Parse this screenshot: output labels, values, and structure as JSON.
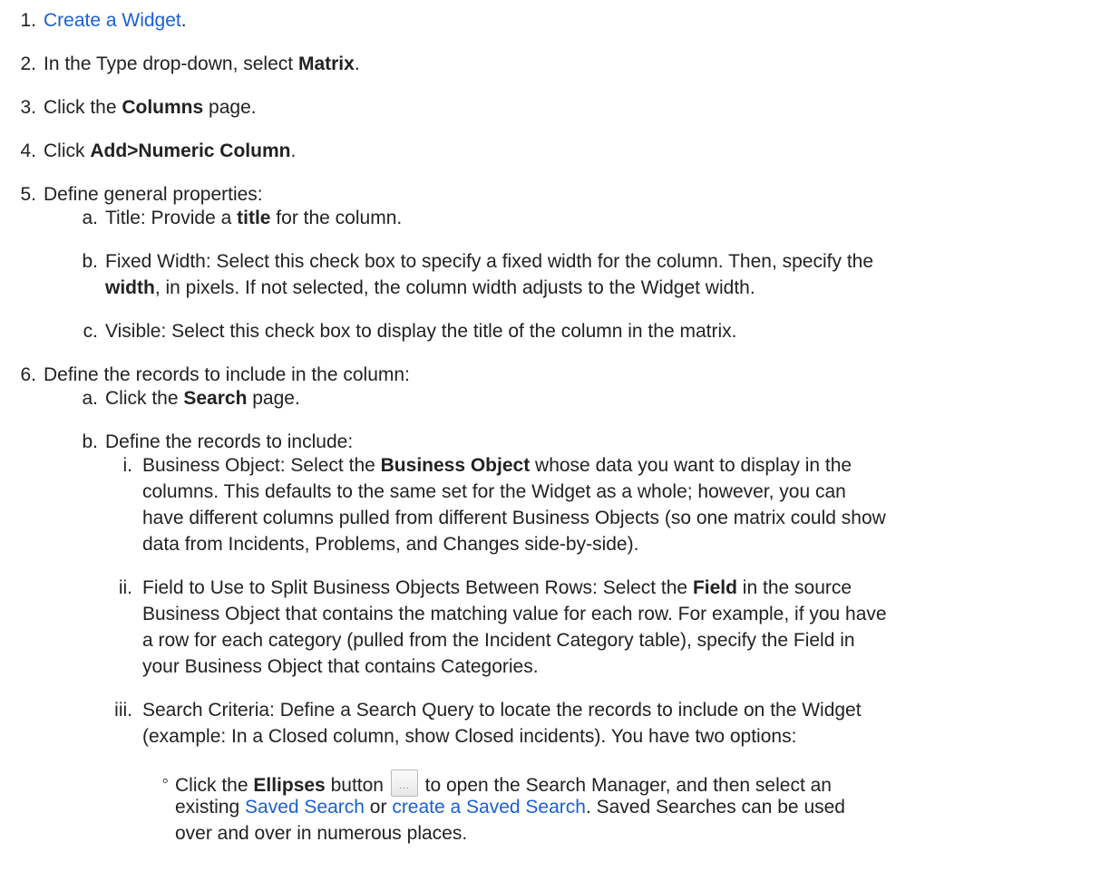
{
  "steps": [
    {
      "num": "1.",
      "link": "Create a Widget",
      "after": "."
    },
    {
      "num": "2.",
      "before": "In the Type drop-down, select ",
      "bold": "Matrix",
      "after": "."
    },
    {
      "num": "3.",
      "before": "Click the ",
      "bold": "Columns",
      "after": " page."
    },
    {
      "num": "4.",
      "before": "Click ",
      "bold": "Add>Numeric Column",
      "after": "."
    },
    {
      "num": "5.",
      "text": "Define general properties:",
      "sub": [
        {
          "num": "a.",
          "before": "Title: Provide a ",
          "bold": "title",
          "after": " for the column."
        },
        {
          "num": "b.",
          "line1": "Fixed Width: Select this check box to specify a fixed width for the column. Then, specify the",
          "bold": "width",
          "after": ", in pixels. If not selected, the column width adjusts to the Widget width."
        },
        {
          "num": "c.",
          "text": "Visible: Select this check box to display the title of the column in the matrix."
        }
      ]
    },
    {
      "num": "6.",
      "text": "Define the records to include in the column:",
      "sub": [
        {
          "num": "a.",
          "before": "Click the ",
          "bold": "Search",
          "after": " page."
        },
        {
          "num": "b.",
          "text": "Define the records to include:",
          "sub": [
            {
              "num": "i.",
              "before": "Business Object: Select the ",
              "bold": "Business Object",
              "line1_after": " whose data you want to display in the",
              "line2": "columns. This defaults to the same set for the Widget as a whole; however, you can",
              "line3": "have different columns pulled from different Business Objects (so one matrix could show",
              "line4": "data from Incidents, Problems, and Changes side-by-side)."
            },
            {
              "num": "ii.",
              "before": "Field to Use to Split Business Objects Between Rows: Select the ",
              "bold": "Field",
              "line1_after": " in the source",
              "line2": "Business Object that contains the matching value for each row. For example, if you have",
              "line3": "a row for each category (pulled from the Incident Category table), specify the Field in",
              "line4": "your Business Object that contains Categories."
            },
            {
              "num": "iii.",
              "line1": "Search Criteria: Define a Search Query to locate the records to include on the Widget",
              "line2": "(example: In a Closed column, show Closed incidents). You have two options:",
              "bullets": [
                {
                  "mark": "◦",
                  "before": "Click the ",
                  "bold": "Ellipses",
                  "mid": " button ",
                  "button_label": "...",
                  "after": " to open the Search Manager, and then select an",
                  "line2_before": "existing ",
                  "link1": "Saved Search",
                  "line2_mid": " or ",
                  "link2": "create a Saved Search",
                  "line2_after": ". Saved Searches can be used",
                  "line3": "over and over in numerous places."
                }
              ]
            }
          ]
        }
      ]
    }
  ]
}
